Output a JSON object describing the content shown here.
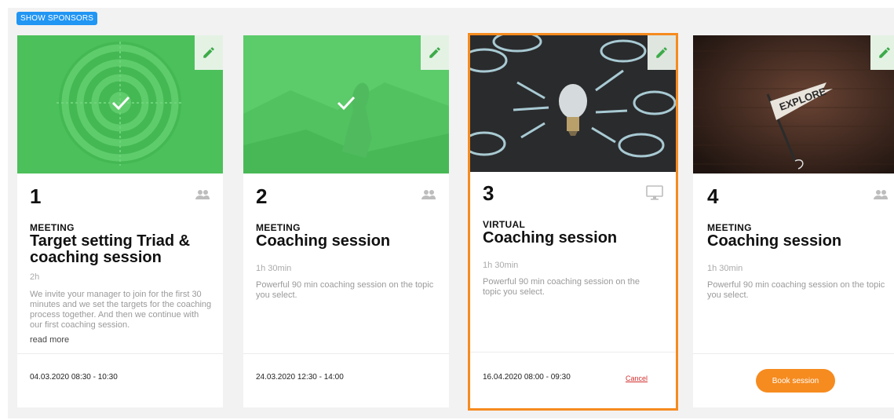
{
  "toolbar": {
    "show_sponsors_label": "SHOW SPONSORS"
  },
  "colors": {
    "accent": "#2196f3",
    "done_overlay": "#4cc05a",
    "highlight": "#f68b1f",
    "cancel": "#d32f2f"
  },
  "sessions": [
    {
      "number": "1",
      "kind": "MEETING",
      "title": "Target setting Triad & coaching session",
      "duration": "2h",
      "description": "We invite your manager to join for the first 30 minutes and we set the targets for the coaching process together. And then we continue with our first coaching session.",
      "read_more": "read more",
      "date": "04.03.2020 08:30 - 10:30",
      "status": "completed",
      "type_icon": "people-icon",
      "image": "target-image"
    },
    {
      "number": "2",
      "kind": "MEETING",
      "title": "Coaching session",
      "duration": "1h 30min",
      "description": "Powerful 90 min coaching session on the topic you select.",
      "date": "24.03.2020 12:30 - 14:00",
      "status": "completed",
      "type_icon": "people-icon",
      "image": "mountain-image"
    },
    {
      "number": "3",
      "kind": "VIRTUAL",
      "title": "Coaching session",
      "duration": "1h 30min",
      "description": "Powerful 90 min coaching session on the topic you select.",
      "date": "16.04.2020 08:00 - 09:30",
      "cancel_label": "Cancel",
      "status": "booked",
      "type_icon": "monitor-icon",
      "image": "lightbulb-image"
    },
    {
      "number": "4",
      "kind": "MEETING",
      "title": "Coaching session",
      "duration": "1h 30min",
      "description": "Powerful 90 min coaching session on the topic you select.",
      "book_label": "Book session",
      "status": "open",
      "type_icon": "people-icon",
      "image": "explore-flag-image",
      "image_text": "EXPLORE"
    }
  ]
}
